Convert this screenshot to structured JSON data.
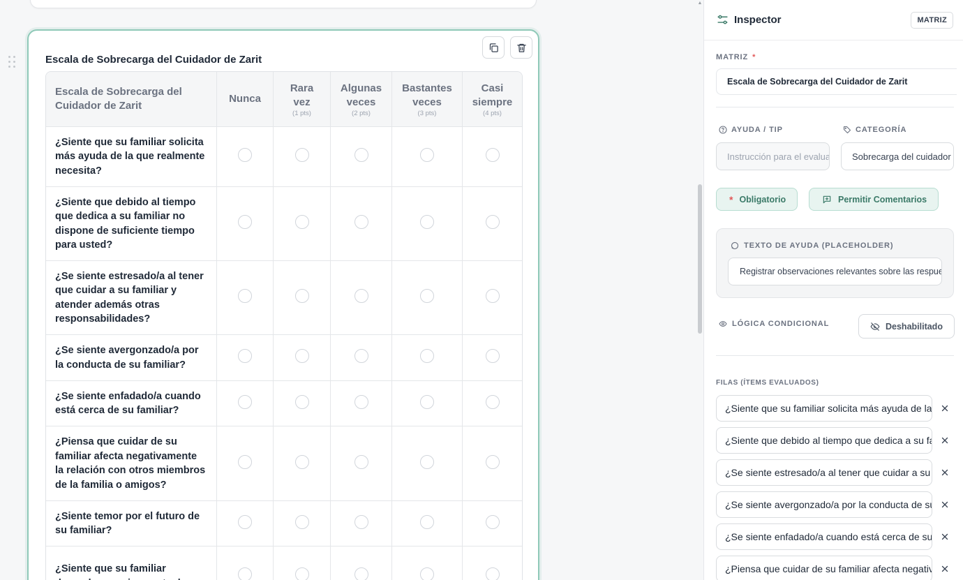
{
  "canvas": {
    "card": {
      "title": "Escala de Sobrecarga del Cuidador de Zarit",
      "column_header": "Escala de Sobrecarga del Cuidador de Zarit",
      "columns": [
        {
          "label": "Nunca",
          "points": ""
        },
        {
          "label": "Rara vez",
          "points": "(1 pts)"
        },
        {
          "label": "Algunas veces",
          "points": "(2 pts)"
        },
        {
          "label": "Bastantes veces",
          "points": "(3 pts)"
        },
        {
          "label": "Casi siempre",
          "points": "(4 pts)"
        }
      ],
      "rows": [
        "¿Siente que su familiar solicita más ayuda de la que realmente necesita?",
        "¿Siente que debido al tiempo que dedica a su familiar no dispone de suficiente tiempo para usted?",
        "¿Se siente estresado/a al tener que cuidar a su familiar y atender además otras responsabilidades?",
        "¿Se siente avergonzado/a por la conducta de su familiar?",
        "¿Se siente enfadado/a cuando está cerca de su familiar?",
        "¿Piensa que cuidar de su familiar afecta negativamente la relación con otros miembros de la familia o amigos?",
        "¿Siente temor por el futuro de su familiar?",
        "¿Siente que su familiar depende excesivamente de"
      ],
      "icons": {
        "duplicate": "copy-icon",
        "delete": "trash-icon",
        "drag": "drag-handle-icon"
      }
    }
  },
  "inspector": {
    "title": "Inspector",
    "type_badge": "MATRIZ",
    "matrix_label": "MATRIZ",
    "required_mark": "*",
    "matrix_name": "Escala de Sobrecarga del Cuidador de Zarit",
    "help_label": "AYUDA / TIP",
    "help_placeholder": "Instrucción para el evaluador",
    "category_label": "CATEGORÍA",
    "category_value": "Sobrecarga del cuidador",
    "required_button": "Obligatorio",
    "required_icon_glyph": "*",
    "comments_button": "Permitir Comentarios",
    "placeholder_label": "TEXTO DE AYUDA (PLACEHOLDER)",
    "placeholder_value": "Registrar observaciones relevantes sobre las respuestas",
    "logic_label": "LÓGICA CONDICIONAL",
    "logic_button": "Deshabilitado",
    "rows_label": "FILAS (ÍTEMS EVALUADOS)",
    "row_items": [
      "¿Siente que su familiar solicita más ayuda de la que realmente necesita?",
      "¿Siente que debido al tiempo que dedica a su familiar no dispone de suficiente tiempo para usted?",
      "¿Se siente estresado/a al tener que cuidar a su familiar y atender además otras responsabilidades?",
      "¿Se siente avergonzado/a por la conducta de su familiar?",
      "¿Se siente enfadado/a cuando está cerca de su familiar?",
      "¿Piensa que cuidar de su familiar afecta negativamente la relación con otros miembros de la familia o amigos?"
    ]
  },
  "colors": {
    "accent": "#8fc9b8",
    "accent_text": "#3b7a68",
    "required": "#e25858"
  }
}
